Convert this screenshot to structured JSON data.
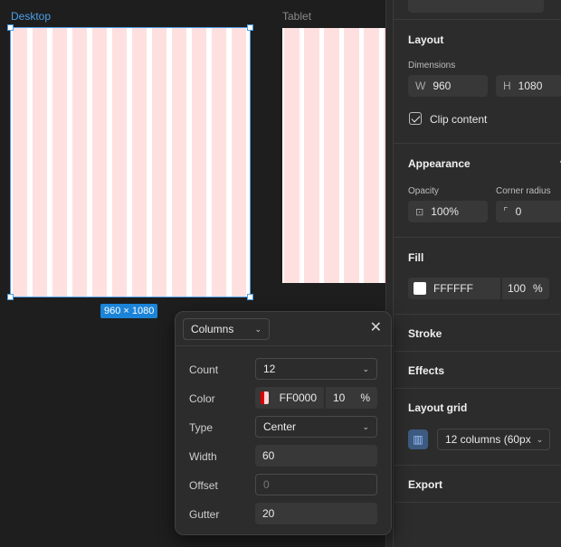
{
  "canvas": {
    "frames": [
      {
        "label": "Desktop",
        "selected": true
      },
      {
        "label": "Tablet",
        "selected": false
      }
    ],
    "size_badge": "960 × 1080",
    "column_color": "#ffe0e0",
    "selection_color": "#4b9fe8"
  },
  "panel": {
    "layout": {
      "title": "Layout",
      "dimensions_label": "Dimensions",
      "w_prefix": "W",
      "w_value": "960",
      "h_prefix": "H",
      "h_value": "1080",
      "clip_label": "Clip content",
      "clip_checked": true
    },
    "appearance": {
      "title": "Appearance",
      "opacity_label": "Opacity",
      "opacity_value": "100%",
      "radius_label": "Corner radius",
      "radius_value": "0"
    },
    "fill": {
      "title": "Fill",
      "color": "FFFFFF",
      "opacity": "100",
      "unit": "%"
    },
    "stroke": {
      "title": "Stroke"
    },
    "effects": {
      "title": "Effects"
    },
    "layout_grid": {
      "title": "Layout grid",
      "value": "12 columns (60px"
    },
    "export": {
      "title": "Export"
    }
  },
  "popup": {
    "type_select": "Columns",
    "rows": {
      "count_label": "Count",
      "count_value": "12",
      "color_label": "Color",
      "color_hex": "FF0000",
      "color_opacity": "10",
      "color_unit": "%",
      "type_label": "Type",
      "type_value": "Center",
      "width_label": "Width",
      "width_value": "60",
      "offset_label": "Offset",
      "offset_placeholder": "0",
      "gutter_label": "Gutter",
      "gutter_value": "20"
    }
  }
}
